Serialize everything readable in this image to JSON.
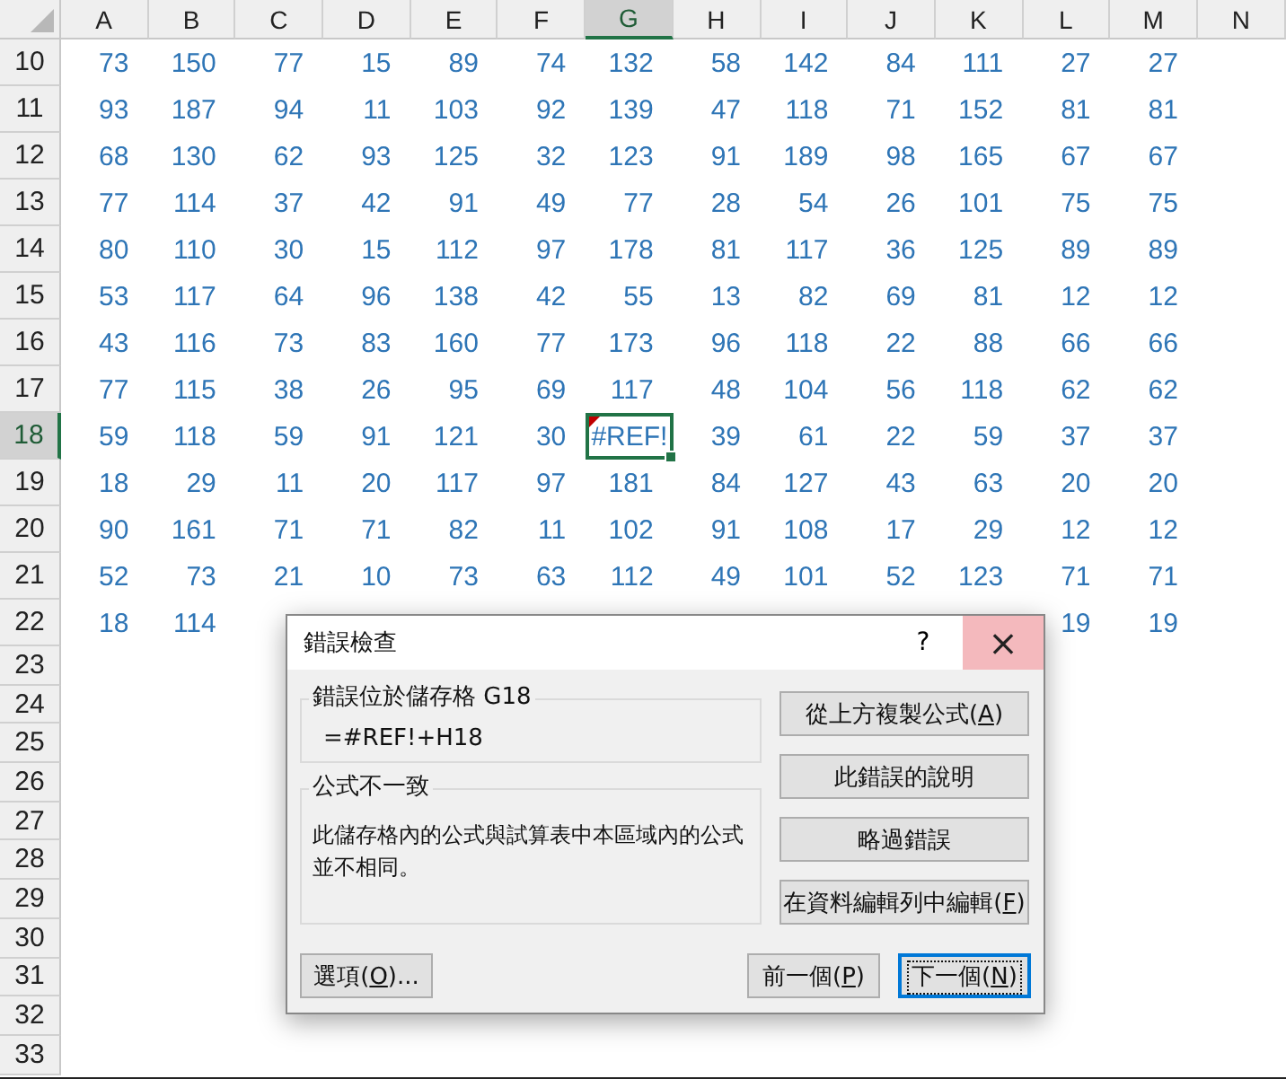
{
  "columns": [
    {
      "label": "A",
      "selected": false
    },
    {
      "label": "B",
      "selected": false
    },
    {
      "label": "C",
      "selected": false
    },
    {
      "label": "D",
      "selected": false
    },
    {
      "label": "E",
      "selected": false
    },
    {
      "label": "F",
      "selected": false
    },
    {
      "label": "G",
      "selected": true
    },
    {
      "label": "H",
      "selected": false
    },
    {
      "label": "I",
      "selected": false
    },
    {
      "label": "J",
      "selected": false
    },
    {
      "label": "K",
      "selected": false
    },
    {
      "label": "L",
      "selected": false
    },
    {
      "label": "M",
      "selected": false
    },
    {
      "label": "N",
      "selected": false
    }
  ],
  "rows": [
    {
      "number": "10",
      "selected": false,
      "cells": [
        "73",
        "150",
        "77",
        "15",
        "89",
        "74",
        "132",
        "58",
        "142",
        "84",
        "111",
        "27",
        "27"
      ]
    },
    {
      "number": "11",
      "selected": false,
      "cells": [
        "93",
        "187",
        "94",
        "11",
        "103",
        "92",
        "139",
        "47",
        "118",
        "71",
        "152",
        "81",
        "81"
      ]
    },
    {
      "number": "12",
      "selected": false,
      "cells": [
        "68",
        "130",
        "62",
        "93",
        "125",
        "32",
        "123",
        "91",
        "189",
        "98",
        "165",
        "67",
        "67"
      ]
    },
    {
      "number": "13",
      "selected": false,
      "cells": [
        "77",
        "114",
        "37",
        "42",
        "91",
        "49",
        "77",
        "28",
        "54",
        "26",
        "101",
        "75",
        "75"
      ]
    },
    {
      "number": "14",
      "selected": false,
      "cells": [
        "80",
        "110",
        "30",
        "15",
        "112",
        "97",
        "178",
        "81",
        "117",
        "36",
        "125",
        "89",
        "89"
      ]
    },
    {
      "number": "15",
      "selected": false,
      "cells": [
        "53",
        "117",
        "64",
        "96",
        "138",
        "42",
        "55",
        "13",
        "82",
        "69",
        "81",
        "12",
        "12"
      ]
    },
    {
      "number": "16",
      "selected": false,
      "cells": [
        "43",
        "116",
        "73",
        "83",
        "160",
        "77",
        "173",
        "96",
        "118",
        "22",
        "88",
        "66",
        "66"
      ]
    },
    {
      "number": "17",
      "selected": false,
      "cells": [
        "77",
        "115",
        "38",
        "26",
        "95",
        "69",
        "117",
        "48",
        "104",
        "56",
        "118",
        "62",
        "62"
      ]
    },
    {
      "number": "18",
      "selected": true,
      "cells": [
        "59",
        "118",
        "59",
        "91",
        "121",
        "30",
        "#REF!",
        "39",
        "61",
        "22",
        "59",
        "37",
        "37"
      ]
    },
    {
      "number": "19",
      "selected": false,
      "cells": [
        "18",
        "29",
        "11",
        "20",
        "117",
        "97",
        "181",
        "84",
        "127",
        "43",
        "63",
        "20",
        "20"
      ]
    },
    {
      "number": "20",
      "selected": false,
      "cells": [
        "90",
        "161",
        "71",
        "71",
        "82",
        "11",
        "102",
        "91",
        "108",
        "17",
        "29",
        "12",
        "12"
      ]
    },
    {
      "number": "21",
      "selected": false,
      "cells": [
        "52",
        "73",
        "21",
        "10",
        "73",
        "63",
        "112",
        "49",
        "101",
        "52",
        "123",
        "71",
        "71"
      ]
    },
    {
      "number": "22",
      "selected": false,
      "cells": [
        "18",
        "114",
        null,
        null,
        null,
        null,
        null,
        null,
        null,
        null,
        null,
        "19",
        "19"
      ]
    },
    {
      "number": "23",
      "selected": false,
      "cells": []
    },
    {
      "number": "24",
      "selected": false,
      "cells": []
    },
    {
      "number": "25",
      "selected": false,
      "cells": []
    },
    {
      "number": "26",
      "selected": false,
      "cells": []
    },
    {
      "number": "27",
      "selected": false,
      "cells": []
    },
    {
      "number": "28",
      "selected": false,
      "cells": []
    },
    {
      "number": "29",
      "selected": false,
      "cells": []
    },
    {
      "number": "30",
      "selected": false,
      "cells": []
    },
    {
      "number": "31",
      "selected": false,
      "cells": []
    },
    {
      "number": "32",
      "selected": false,
      "cells": []
    },
    {
      "number": "33",
      "selected": false,
      "cells": []
    }
  ],
  "dialog": {
    "title": "錯誤檢查",
    "help": "?",
    "close": "×",
    "location_group": {
      "title": "錯誤位於儲存格 G18",
      "formula": "=#REF!+H18"
    },
    "message_group": {
      "title": "公式不一致",
      "text": "此儲存格內的公式與試算表中本區域內的公式並不相同。"
    },
    "side_buttons": [
      {
        "label": "從上方複製公式(",
        "access_key": "A",
        "label_end": ")"
      },
      {
        "label": "此錯誤的說明"
      },
      {
        "label": "略過錯誤"
      },
      {
        "label": "在資料編輯列中編輯(",
        "access_key": "F",
        "label_end": ")"
      }
    ],
    "bottom_buttons": [
      {
        "label": "選項(",
        "access_key": "O",
        "label_end": ")...",
        "default": false
      },
      {
        "label": "前一個(",
        "access_key": "P",
        "label_end": ")",
        "default": false
      },
      {
        "label": "下一個(",
        "access_key": "N",
        "label_end": ")",
        "default": true
      }
    ]
  }
}
